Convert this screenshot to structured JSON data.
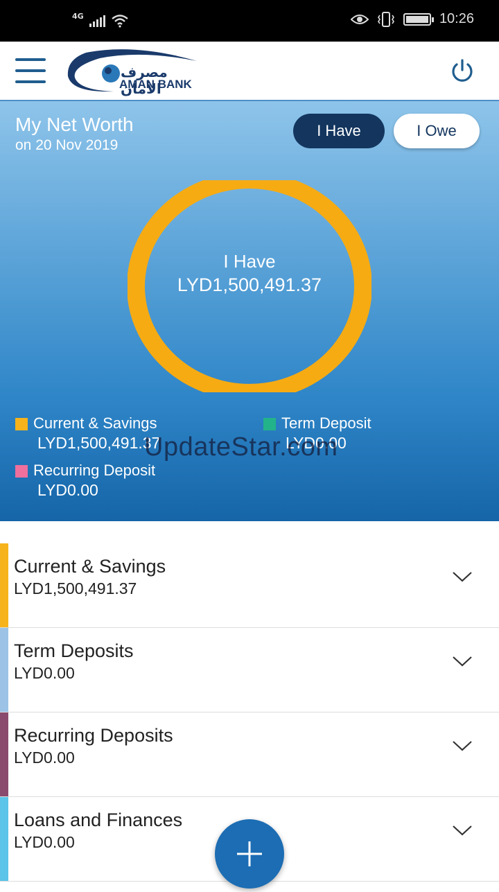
{
  "status_bar": {
    "network": "4G",
    "time": "10:26",
    "signal_icon": "signal-icon",
    "wifi_icon": "wifi-icon",
    "eye_icon": "eye-icon",
    "vibrate_icon": "vibrate-icon",
    "battery_icon": "battery-icon"
  },
  "header": {
    "logo_arabic": "مصرف الأمان",
    "logo_english": "AMAN BANK",
    "menu_icon": "menu-icon",
    "power_icon": "power-icon"
  },
  "networth": {
    "title": "My Net Worth",
    "date": "on 20 Nov 2019",
    "toggle_have": "I Have",
    "toggle_owe": "I Owe",
    "donut_label": "I Have",
    "donut_value": "LYD1,500,491.37",
    "legend": [
      {
        "name": "Current & Savings",
        "amount": "LYD1,500,491.37",
        "color": "#f6b31b"
      },
      {
        "name": "Term Deposit",
        "amount": "LYD0.00",
        "color": "#22b38a"
      },
      {
        "name": "Recurring Deposit",
        "amount": "LYD0.00",
        "color": "#ef6f9d"
      }
    ],
    "ring_color": "#f6ab13",
    "watermark": "UpdateStar.com"
  },
  "accounts": [
    {
      "name": "Current & Savings",
      "amount": "LYD1,500,491.37",
      "color": "#f6b31b"
    },
    {
      "name": "Term Deposits",
      "amount": "LYD0.00",
      "color": "#9cc3e6"
    },
    {
      "name": "Recurring Deposits",
      "amount": "LYD0.00",
      "color": "#8a4a6e"
    },
    {
      "name": "Loans and Finances",
      "amount": "LYD0.00",
      "color": "#5bc4e8"
    }
  ],
  "fab_icon": "plus-icon"
}
